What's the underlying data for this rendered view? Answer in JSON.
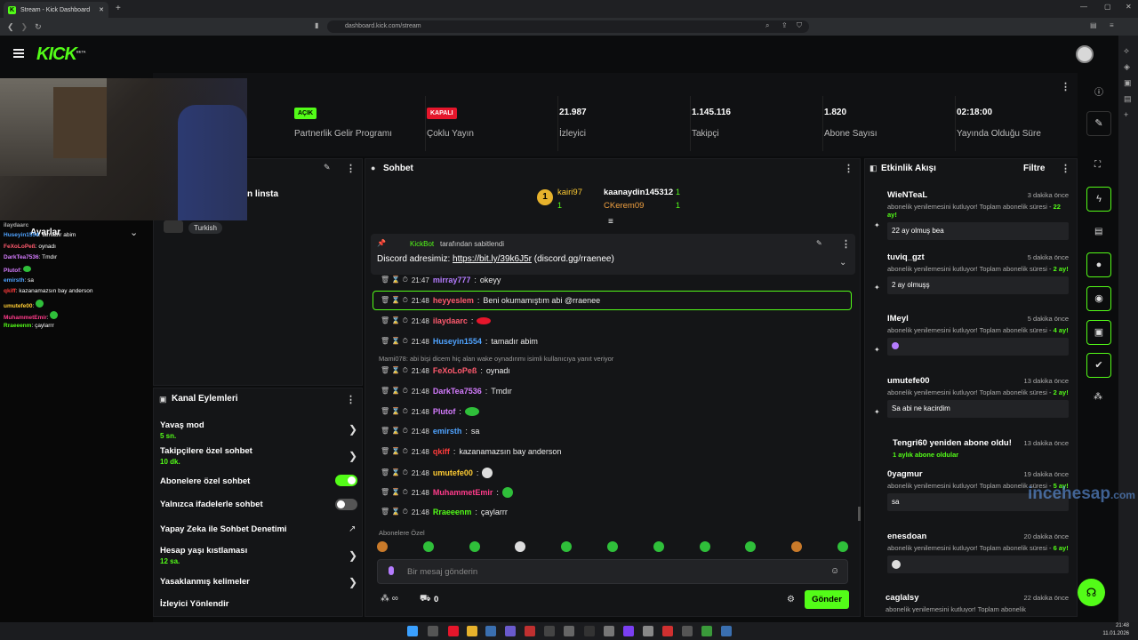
{
  "browser": {
    "tab_title": "Stream - Kick Dashboard",
    "url": "dashboard.kick.com/stream",
    "clock": "21:48",
    "date": "11.01.2026"
  },
  "header": {
    "logo": "KICK",
    "logo_beta": "BETA"
  },
  "stats": [
    {
      "value": "AÇIK",
      "label": "Partnerlik Gelir Programı",
      "kind": "on"
    },
    {
      "value": "KAPALI",
      "label": "Çoklu Yayın",
      "kind": "off"
    },
    {
      "value": "21.987",
      "label": "İzleyici"
    },
    {
      "value": "1.145.116",
      "label": "Takipçi"
    },
    {
      "value": "1.820",
      "label": "Abone Sayısı"
    },
    {
      "value": "02:18:00",
      "label": "Yayında Olduğu Süre"
    }
  ],
  "stream_info": {
    "title_fragment": "n linsta",
    "language": "Turkish",
    "settings_label": "Ayarlar"
  },
  "overlay_chat": [
    {
      "user": "ilaydaarc",
      "text": ""
    },
    {
      "user": "Huseyin1554",
      "text": "tamadır abim"
    },
    {
      "user": "FeXoLoPeß",
      "text": "oynadı"
    },
    {
      "user": "DarkTea7536",
      "text": "Tmdır"
    },
    {
      "user": "Plutof",
      "text": ""
    },
    {
      "user": "emirsth",
      "text": "sa"
    },
    {
      "user": "qkiff",
      "text": "kazanamazsın bay anderson"
    },
    {
      "user": "umutefe00",
      "text": ""
    },
    {
      "user": "MuhammetEmir",
      "text": ""
    },
    {
      "user": "Rraeeenm",
      "text": "çaylarrr"
    }
  ],
  "chat": {
    "title": "Sohbet",
    "top": [
      {
        "rank": "1",
        "name": "kairi97",
        "count": "1"
      },
      {
        "name": "kaanaydin145312",
        "count": "1"
      },
      {
        "name": "CKerem09",
        "count": "1"
      }
    ],
    "pinned_by": "KickBot",
    "pinned_suffix": "tarafından sabitlendi",
    "pinned_text": "Discord adresimiz:",
    "pinned_link": "https://bit.ly/39k6J5r",
    "pinned_tail": "(discord.gg/rraenee)",
    "reply_note": "Mami078: abi bişi dicem hiç alan wake oynadınmı isimli kullanıcıya yanıt veriyor",
    "messages": [
      {
        "time": "21:47",
        "user": "mirray777",
        "text": "okeyy",
        "color": "#b57cff"
      },
      {
        "time": "21:48",
        "user": "heyyeslem",
        "text": "Beni okumamıştım abi @rraenee",
        "color": "#ff5a6e"
      },
      {
        "time": "21:48",
        "user": "ilaydaarc",
        "text": "",
        "color": "#ff5a6e"
      },
      {
        "time": "21:48",
        "user": "Huseyin1554",
        "text": "tamadır abim",
        "color": "#4fa3ff"
      },
      {
        "time": "21:48",
        "user": "FeXoLoPeß",
        "text": "oynadı",
        "color": "#ff5a6e"
      },
      {
        "time": "21:48",
        "user": "DarkTea7536",
        "text": "Tmdır",
        "color": "#d57cff"
      },
      {
        "time": "21:48",
        "user": "Plutof",
        "text": "",
        "color": "#d57cff"
      },
      {
        "time": "21:48",
        "user": "emirsth",
        "text": "sa",
        "color": "#4fa3ff"
      },
      {
        "time": "21:48",
        "user": "qkiff",
        "text": "kazanamazsın bay anderson",
        "color": "#ff3b3b"
      },
      {
        "time": "21:48",
        "user": "umutefe00",
        "text": "",
        "color": "#ffcc33"
      },
      {
        "time": "21:48",
        "user": "MuhammetEmir",
        "text": "",
        "color": "#ff3b8a"
      },
      {
        "time": "21:48",
        "user": "Rraeeenm",
        "text": "çaylarrr",
        "color": "#53fc18"
      }
    ],
    "subscriber_label": "Abonelere Özel",
    "input_placeholder": "Bir mesaj gönderin",
    "send_label": "Gönder",
    "points": "0"
  },
  "channel_actions": {
    "title": "Kanal Eylemleri",
    "items": [
      {
        "label": "Yavaş mod",
        "sub": "5 sn.",
        "ctrl": "chevron"
      },
      {
        "label": "Takipçilere özel sohbet",
        "sub": "10 dk.",
        "ctrl": "chevron"
      },
      {
        "label": "Abonelere özel sohbet",
        "sub": "",
        "ctrl": "on"
      },
      {
        "label": "Yalnızca ifadelerle sohbet",
        "sub": "",
        "ctrl": "off"
      },
      {
        "label": "Yapay Zeka ile Sohbet Denetimi",
        "sub": "",
        "ctrl": "ext"
      },
      {
        "label": "Hesap yaşı kıstlaması",
        "sub": "12 sa.",
        "ctrl": "chevron"
      },
      {
        "label": "Yasaklanmış kelimeler",
        "sub": "",
        "ctrl": "chevron"
      },
      {
        "label": "İzleyici Yönlendir",
        "sub": "",
        "ctrl": ""
      }
    ]
  },
  "activity": {
    "title": "Etkinlik Akışı",
    "filter": "Filtre",
    "items": [
      {
        "name": "WieNTeaL",
        "time": "3 dakika önce",
        "d1": "abonelik yenilemesini kutluyor! Toplam abonelik süresi - ",
        "months": "22 ay!",
        "quote": "22 ay olmuş bea"
      },
      {
        "name": "tuviq_gzt",
        "time": "5 dakika önce",
        "d1": "abonelik yenilemesini kutluyor! Toplam abonelik süresi - ",
        "months": "2 ay!",
        "quote": "2 ay olmuşş"
      },
      {
        "name": "IMeyl",
        "time": "5 dakika önce",
        "d1": "abonelik yenilemesini kutluyor! Toplam abonelik süresi - ",
        "months": "4 ay!",
        "quote": ""
      },
      {
        "name": "umutefe00",
        "time": "13 dakika önce",
        "d1": "abonelik yenilemesini kutluyor! Toplam abonelik süresi - ",
        "months": "2 ay!",
        "quote": "Sa abi ne kacirdim"
      },
      {
        "name": "Tengri60 yeniden abone oldu!",
        "time": "13 dakika önce",
        "d1": "",
        "months": "1 aylık abone oldular",
        "quote": ""
      },
      {
        "name": "0yagmur",
        "time": "19 dakika önce",
        "d1": "abonelik yenilemesini kutluyor! Toplam abonelik süresi - ",
        "months": "5 ay!",
        "quote": "sa"
      },
      {
        "name": "enesdoan",
        "time": "20 dakika önce",
        "d1": "abonelik yenilemesini kutluyor! Toplam abonelik süresi - ",
        "months": "6 ay!",
        "quote": ""
      },
      {
        "name": "caglalsy",
        "time": "22 dakika önce",
        "d1": "abonelik yenilemesini kutluyor! Toplam abonelik",
        "months": "",
        "quote": ""
      }
    ]
  },
  "watermark": "incehesap",
  "watermark_suffix": ".com"
}
